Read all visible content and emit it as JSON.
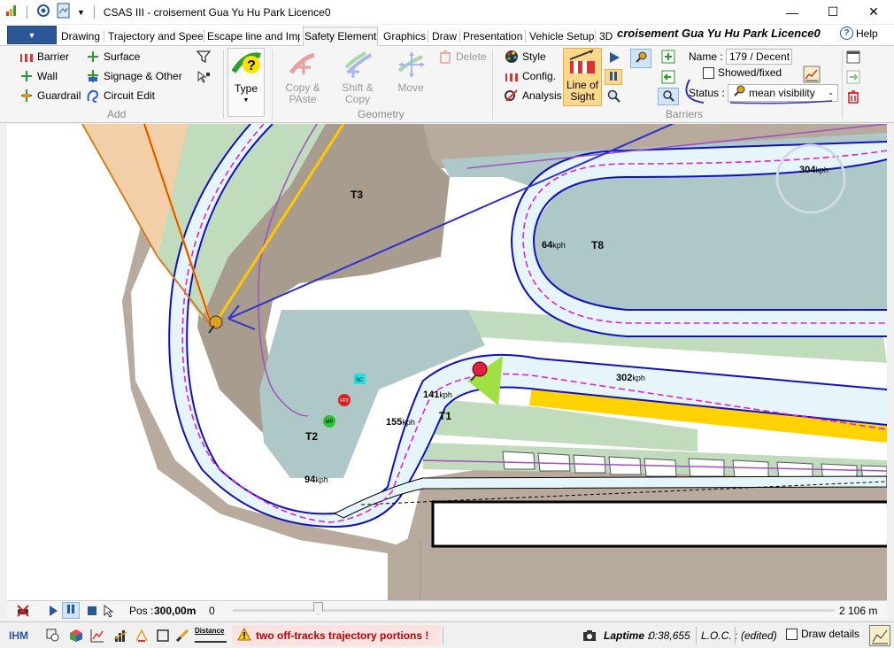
{
  "window": {
    "title": "CSAS III - croisement Gua Yu Hu Park Licence0",
    "minimize": "—",
    "maximize": "☐",
    "close": "✕"
  },
  "tabs": [
    {
      "label": "Drawing"
    },
    {
      "label": "Trajectory and Spee"
    },
    {
      "label": "Escape line and Imp"
    },
    {
      "label": "Safety Element",
      "active": true
    },
    {
      "label": "Graphics"
    },
    {
      "label": "Draw"
    },
    {
      "label": "Presentation"
    },
    {
      "label": "Vehicle Setup"
    },
    {
      "label": "3D"
    }
  ],
  "document_title": "croisement Gua Yu Hu Park Licence0",
  "help_label": "Help",
  "ribbon": {
    "add": {
      "barrier": "Barrier",
      "wall": "Wall",
      "guardrail": "Guardrail",
      "surface": "Surface",
      "signage": "Signage & Other",
      "circuit_edit": "Circuit Edit",
      "group": "Add"
    },
    "type_label": "Type",
    "geometry": {
      "copy_paste": [
        "Copy &",
        "PAste"
      ],
      "shift_copy": [
        "Shift &",
        "Copy"
      ],
      "move": "Move",
      "delete": "Delete",
      "group": "Geometry"
    },
    "style": "Style",
    "config": "Config.",
    "analysis": "Analysis",
    "line_of_sight": [
      "Line of",
      "Sight"
    ],
    "barriers_group": "Barriers",
    "name_label": "Name :",
    "name_value": "179 / Decent",
    "showed_fixed": "Showed/fixed",
    "status_label": "Status :",
    "status_value": "mean visibility"
  },
  "map_labels": {
    "t1": "T1",
    "t2": "T2",
    "t3": "T3",
    "t8": "T8",
    "mp": "MP",
    "fp": "FP2",
    "sc": "SC",
    "speeds": [
      {
        "value": "304",
        "unit": "kph"
      },
      {
        "value": "64",
        "unit": "kph"
      },
      {
        "value": "302",
        "unit": "kph"
      },
      {
        "value": "141",
        "unit": "kph"
      },
      {
        "value": "155",
        "unit": "kph"
      },
      {
        "value": "94",
        "unit": "kph"
      }
    ]
  },
  "posbar": {
    "pos_label": "Pos :",
    "pos_value": "300,00m",
    "start": "0",
    "end": "2 106 m",
    "position_fraction": 0.142
  },
  "statusbar": {
    "ihm": "IHM",
    "distance": "Distance",
    "warning": "two off-tracks trajectory portions !",
    "laptime_label": "Laptime :",
    "laptime_value": "0:38,655",
    "loc": "L.O.C. :",
    "edited": "(edited)",
    "draw_details": "Draw details"
  },
  "colors": {
    "accent": "#2b5797",
    "trajectory": "#e020e0",
    "track_edge": "#1010c0",
    "sight_line": "#ffc800",
    "warning_text": "#c00000",
    "runoff": "#aec8c8",
    "grass": "#c0dcbc",
    "gravel": "#b8aa9c",
    "yellow_zone": "#ffd200"
  }
}
